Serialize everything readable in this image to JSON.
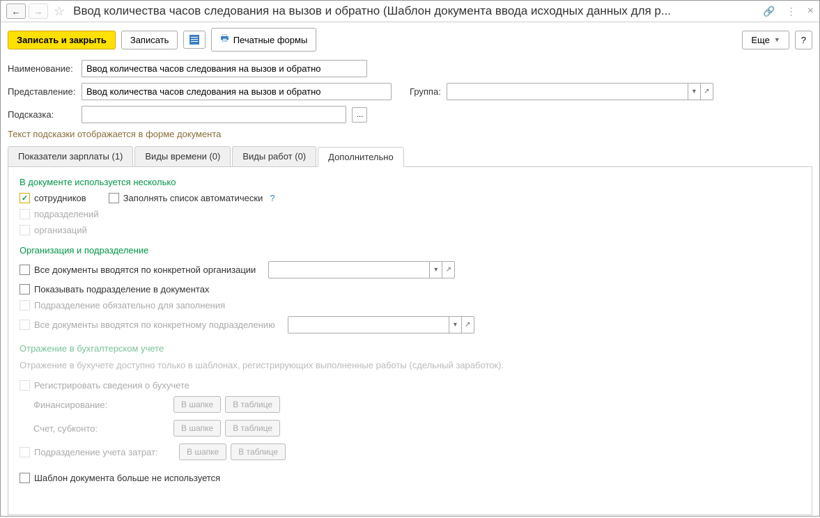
{
  "title": "Ввод количества часов следования на вызов и обратно (Шаблон документа ввода исходных данных для р...",
  "toolbar": {
    "save_close": "Записать и закрыть",
    "save": "Записать",
    "print_forms": "Печатные формы",
    "more": "Еще",
    "help": "?"
  },
  "form": {
    "name_label": "Наименование:",
    "name_value": "Ввод количества часов следования на вызов и обратно",
    "repr_label": "Представление:",
    "repr_value": "Ввод количества часов следования на вызов и обратно",
    "group_label": "Группа:",
    "group_value": "",
    "hint_label": "Подсказка:",
    "hint_value": "",
    "hint_info": "Текст подсказки отображается в форме документа"
  },
  "tabs": {
    "t0": "Показатели зарплаты (1)",
    "t1": "Виды времени (0)",
    "t2": "Виды работ (0)",
    "t3": "Дополнительно"
  },
  "extra": {
    "multi_title": "В документе используется несколько",
    "chk_employees": "сотрудников",
    "chk_autofill": "Заполнять список автоматически",
    "chk_depts": "подразделений",
    "chk_orgs": "организаций",
    "org_title": "Организация и подразделение",
    "chk_all_docs_org": "Все документы вводятся по конкретной организации",
    "chk_show_dept": "Показывать подразделение в документах",
    "chk_dept_required": "Подразделение обязательно для заполнения",
    "chk_all_docs_dept": "Все документы вводятся по конкретному подразделению",
    "acc_title": "Отражение в бухгалтерском учете",
    "acc_hint": "Отражение в бухучете доступно только в шаблонах, регистрирующих выполненные работы (сдельный заработок).",
    "chk_reg_acc": "Регистрировать сведения о бухучете",
    "lbl_financing": "Финансирование:",
    "lbl_account": "Счет, субконто:",
    "chk_cost_dept": "Подразделение учета затрат:",
    "btn_header": "В шапке",
    "btn_table": "В таблице",
    "chk_not_used": "Шаблон документа больше не используется"
  }
}
